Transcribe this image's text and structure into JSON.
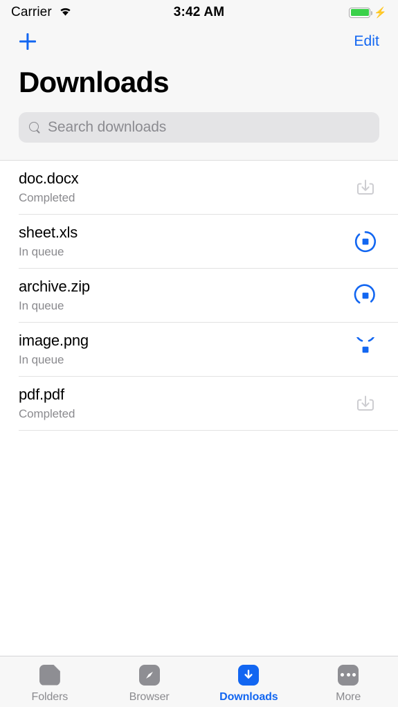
{
  "status_bar": {
    "carrier": "Carrier",
    "wifi_icon": "wifi-icon",
    "time": "3:42 AM",
    "battery_icon": "battery-icon",
    "battery_level_percent": 100,
    "charging_icon": "lightning-bolt-icon"
  },
  "nav": {
    "add_label": "+",
    "add_icon": "plus-icon",
    "edit_label": "Edit",
    "title": "Downloads"
  },
  "search": {
    "icon": "search-icon",
    "placeholder": "Search downloads",
    "value": ""
  },
  "downloads": [
    {
      "name": "doc.docx",
      "status": "Completed",
      "action_icon": "download-tray-icon",
      "state": "completed"
    },
    {
      "name": "sheet.xls",
      "status": "In queue",
      "action_icon": "stop-progress-icon",
      "state": "queued"
    },
    {
      "name": "archive.zip",
      "status": "In queue",
      "action_icon": "stop-progress-icon",
      "state": "queued"
    },
    {
      "name": "image.png",
      "status": "In queue",
      "action_icon": "stop-progress-icon",
      "state": "queued"
    },
    {
      "name": "pdf.pdf",
      "status": "Completed",
      "action_icon": "download-tray-icon",
      "state": "completed"
    }
  ],
  "tab_bar": {
    "items": [
      {
        "label": "Folders",
        "icon": "folder-icon",
        "active": false
      },
      {
        "label": "Browser",
        "icon": "compass-icon",
        "active": false
      },
      {
        "label": "Downloads",
        "icon": "download-icon",
        "active": true
      },
      {
        "label": "More",
        "icon": "ellipsis-icon",
        "active": false
      }
    ]
  },
  "colors": {
    "accent": "#1266f1",
    "inactive": "#8e8e93",
    "battery_green": "#3ad14a",
    "header_bg": "#f7f7f7",
    "search_bg": "#e4e4e6"
  }
}
